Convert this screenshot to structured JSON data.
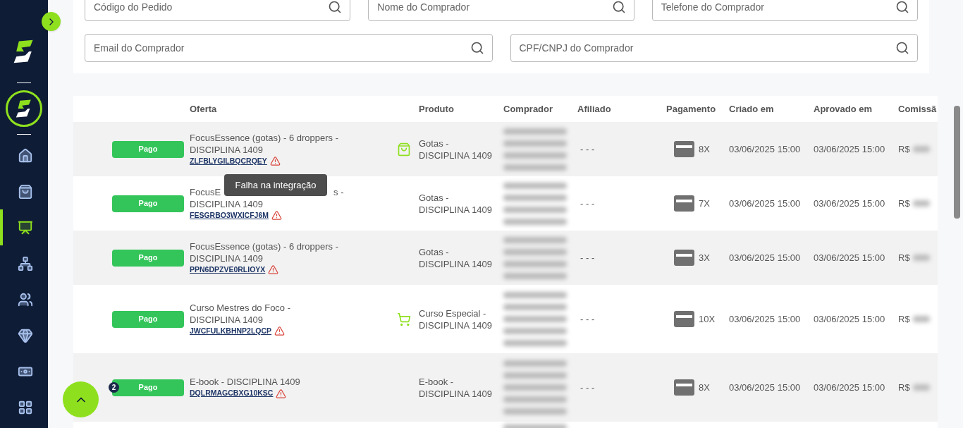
{
  "sidebar": {
    "items": [
      {
        "kind": "home",
        "selected": false
      },
      {
        "kind": "bag",
        "selected": false
      },
      {
        "kind": "board",
        "selected": true
      },
      {
        "kind": "network",
        "selected": false
      },
      {
        "kind": "users",
        "selected": false
      },
      {
        "kind": "gem",
        "selected": false
      },
      {
        "kind": "money",
        "selected": false
      },
      {
        "kind": "grid",
        "selected": false
      }
    ]
  },
  "filters": [
    {
      "placeholder": "Código do Pedido"
    },
    {
      "placeholder": "Nome do Comprador"
    },
    {
      "placeholder": "Telefone do Comprador"
    },
    {
      "placeholder": "Email do Comprador"
    },
    {
      "placeholder": "CPF/CNPJ do Comprador"
    }
  ],
  "table": {
    "columns": [
      "",
      "Oferta",
      "",
      "Produto",
      "Comprador",
      "Afiliado",
      "Pagamento",
      "Criado em",
      "Aprovado em",
      "Comissã"
    ],
    "rows": [
      {
        "status": "Pago",
        "offer": "FocusEssence (gotas) - 6 droppers - DISCIPLINA 1409",
        "code": "ZLFBLYGILBQCRQEY",
        "warning": true,
        "kind": "bag",
        "product": "Gotas - DISCIPLINA 1409",
        "affiliate": "- - -",
        "installments": "8X",
        "created": "03/06/2025 15:00",
        "approved": "03/06/2025 15:00",
        "commission": "R$"
      },
      {
        "status": "Pago",
        "offer_head": "FocusE",
        "offer_tail": "s -",
        "offer": "DISCIPLINA 1409",
        "code": "FESGRBO3WXICFJ6M",
        "warning": true,
        "kind": "plain",
        "product": "Gotas - DISCIPLINA 1409",
        "affiliate": "- - -",
        "installments": "7X",
        "created": "03/06/2025 15:00",
        "approved": "03/06/2025 15:00",
        "commission": "R$"
      },
      {
        "status": "Pago",
        "offer": "FocusEssence (gotas) - 6 droppers - DISCIPLINA 1409",
        "code": "PPN6DPZVE0RLIOYX",
        "warning": true,
        "kind": "plain",
        "product": "Gotas - DISCIPLINA 1409",
        "affiliate": "- - -",
        "installments": "3X",
        "created": "03/06/2025 15:00",
        "approved": "03/06/2025 15:00",
        "commission": "R$"
      },
      {
        "status": "Pago",
        "offer": "Curso Mestres do Foco - DISCIPLINA 1409",
        "code": "JWCFULKBHNP2LQCP",
        "warning": true,
        "kind": "cart",
        "product": "Curso Especial - DISCIPLINA 1409",
        "affiliate": "- - -",
        "installments": "10X",
        "created": "03/06/2025 15:00",
        "approved": "03/06/2025 15:00",
        "commission": "R$"
      },
      {
        "status": "Pago",
        "badge": "2",
        "offer": "E-book - DISCIPLINA 1409",
        "code": "DQLRMAGCBXG10KSC",
        "warning": true,
        "kind": "plain",
        "product": "E-book - DISCIPLINA 1409",
        "affiliate": "- - -",
        "installments": "8X",
        "created": "03/06/2025 15:00",
        "approved": "03/06/2025 15:00",
        "commission": "R$"
      }
    ]
  },
  "tooltip": {
    "text": "Falha na integração"
  }
}
